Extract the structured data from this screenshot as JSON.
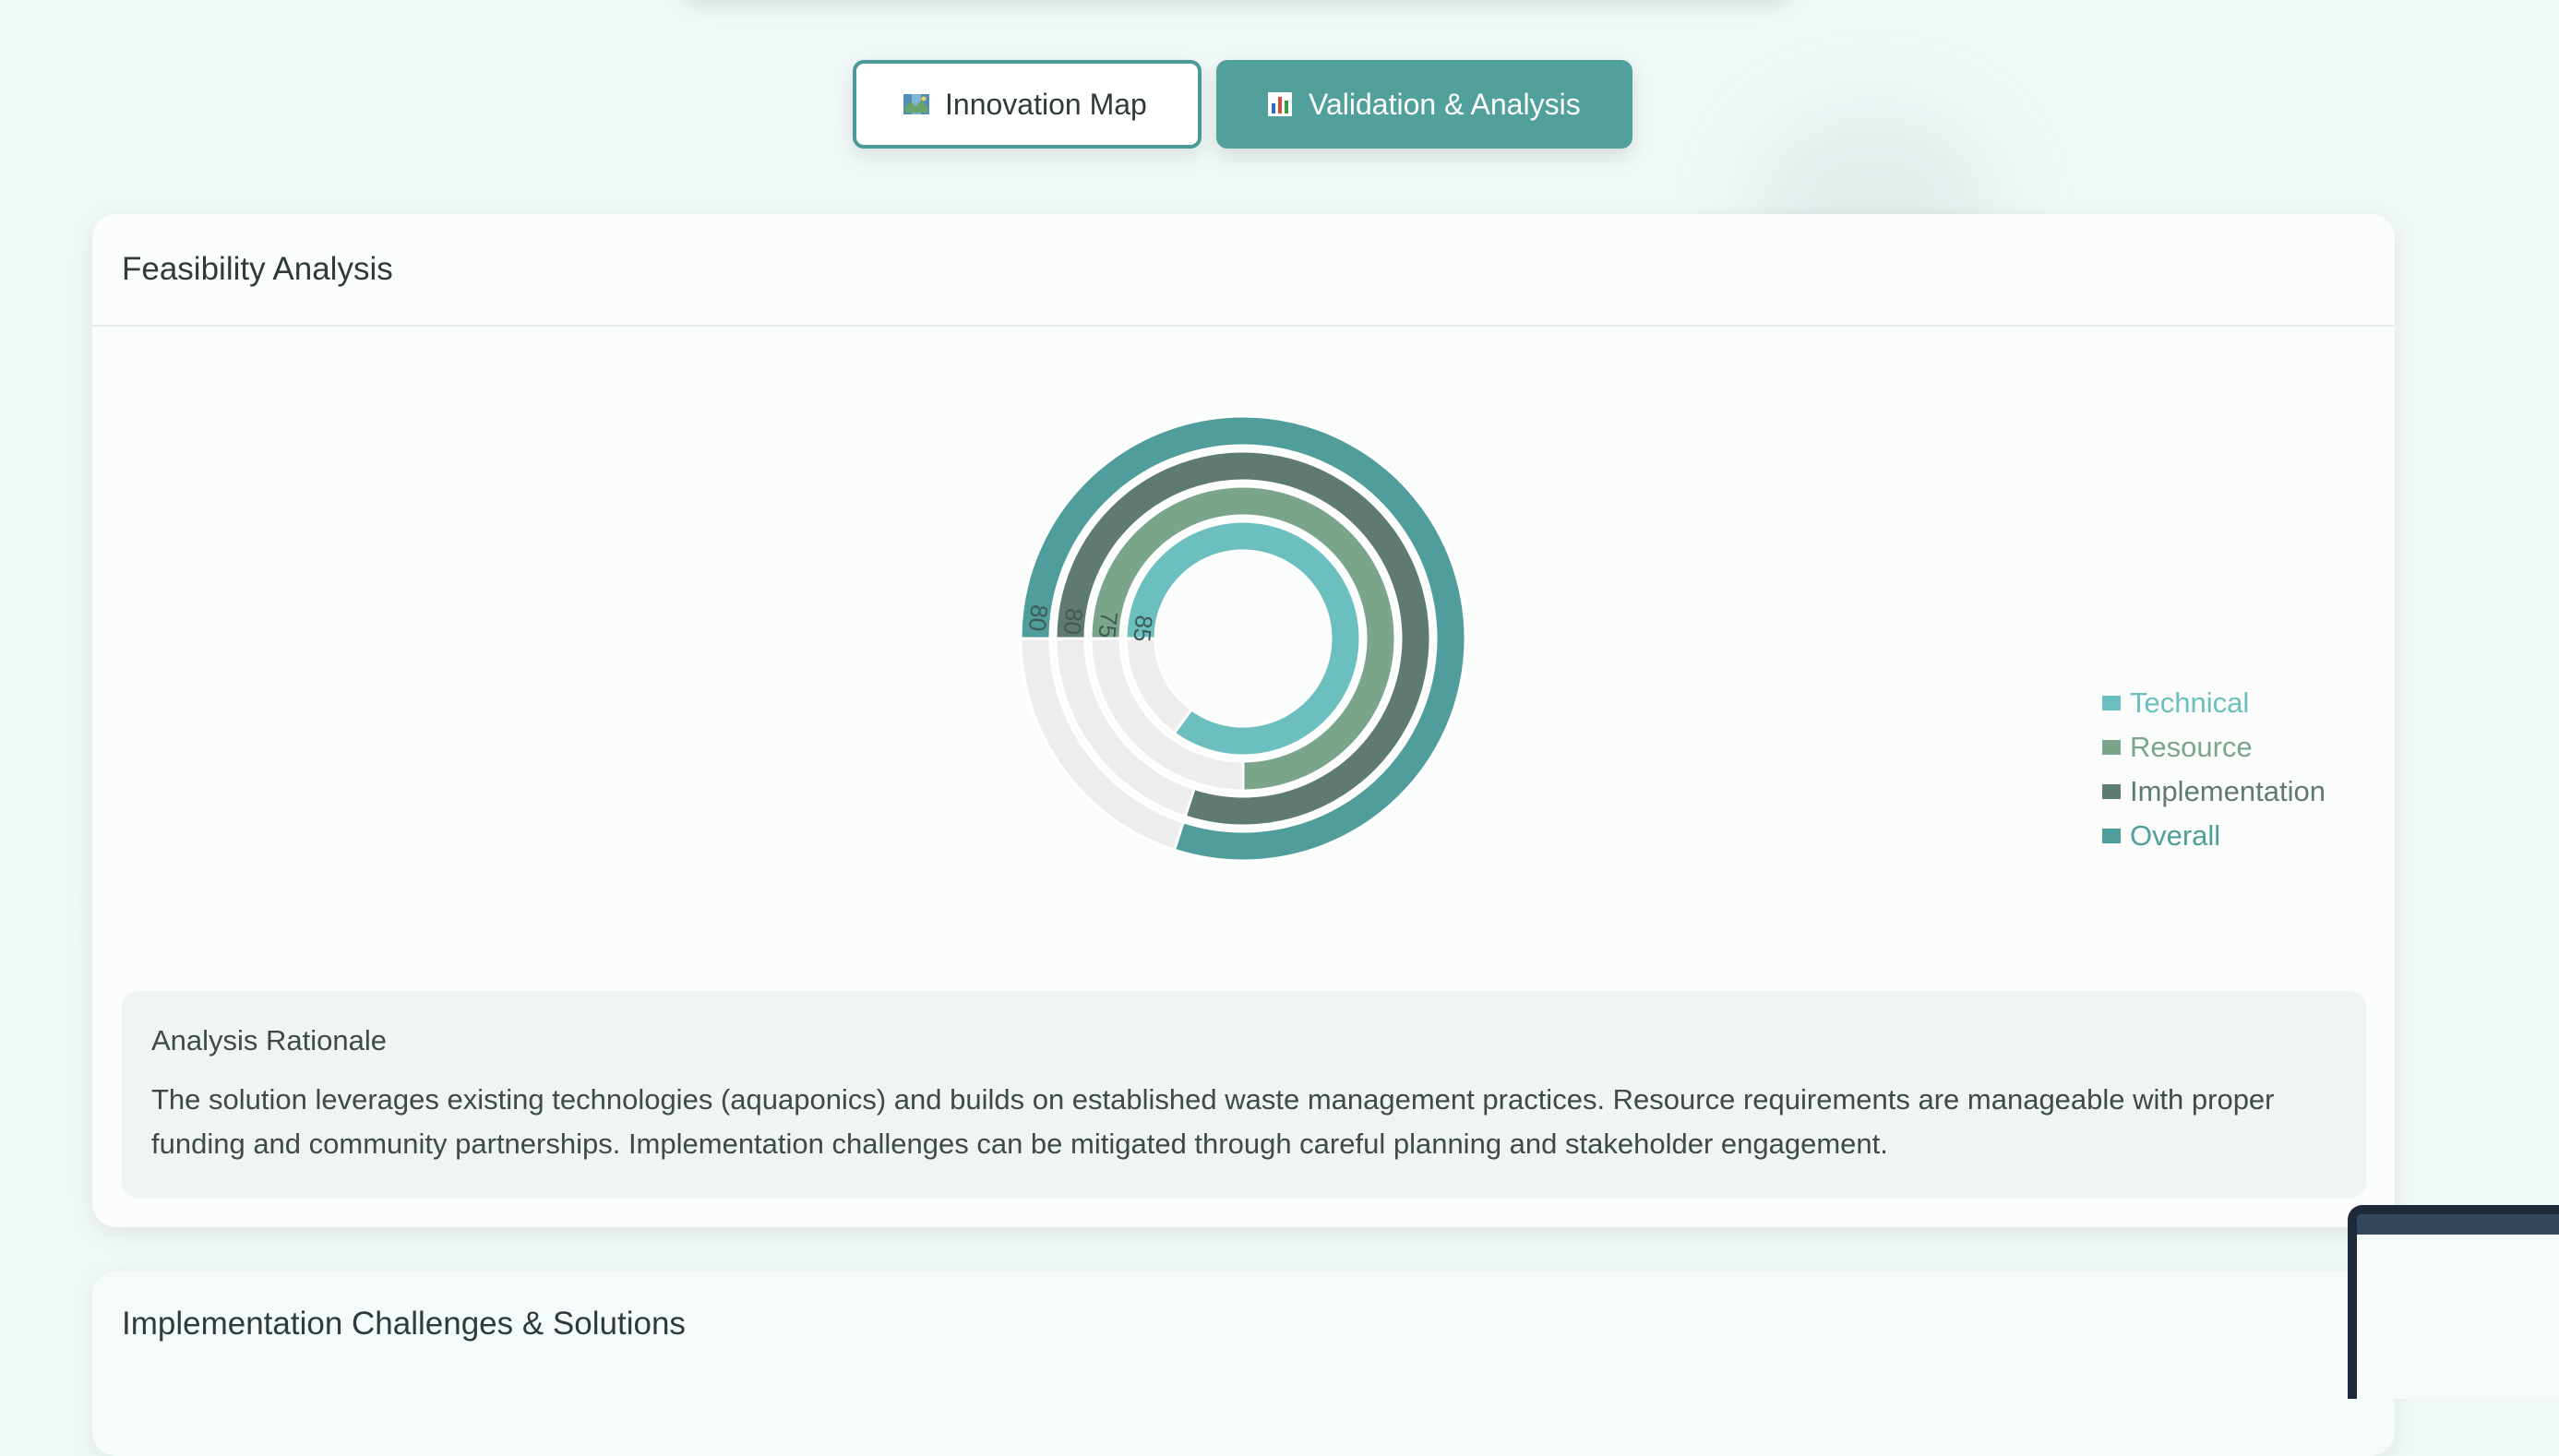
{
  "tabs": [
    {
      "label": "Innovation Map",
      "icon": "map-icon",
      "active": false
    },
    {
      "label": "Validation & Analysis",
      "icon": "bar-chart-icon",
      "active": true
    }
  ],
  "feasibility": {
    "title": "Feasibility Analysis",
    "rationale_title": "Analysis Rationale",
    "rationale_text": "The solution leverages existing technologies (aquaponics) and builds on established waste management practices. Resource requirements are manageable with proper funding and community partnerships. Implementation challenges can be mitigated through careful planning and stakeholder engagement."
  },
  "chart_data": {
    "type": "radial-bar",
    "title": "",
    "max": 100,
    "series": [
      {
        "name": "Technical",
        "value": 85,
        "color": "#6bbfbf"
      },
      {
        "name": "Resource",
        "value": 75,
        "color": "#7aa58a"
      },
      {
        "name": "Implementation",
        "value": 80,
        "color": "#5f7a70"
      },
      {
        "name": "Overall",
        "value": 80,
        "color": "#4f9e9b"
      }
    ],
    "legend_position": "right",
    "remainder_color": "#ededed"
  },
  "challenges": {
    "title": "Implementation Challenges & Solutions"
  }
}
